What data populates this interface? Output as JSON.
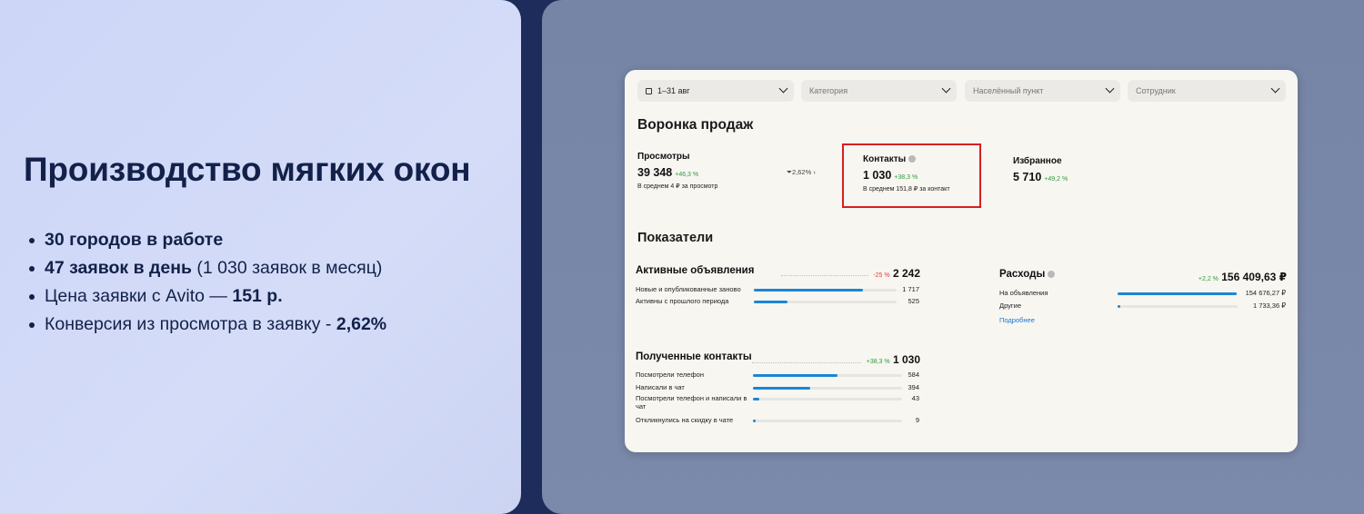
{
  "slide": {
    "title": "Производство мягких окон",
    "bullets": [
      {
        "bold": "30 городов в работе",
        "text": ""
      },
      {
        "bold": "47 заявок в день",
        "text": " (1 030 заявок в месяц)"
      },
      {
        "text": "Цена заявки с Avito — ",
        "bold": "151 р."
      },
      {
        "text": "Конверсия из просмотра в заявку - ",
        "bold": "2,62%"
      }
    ]
  },
  "filters": {
    "period": "1–31 авг",
    "category": "Категория",
    "location": "Населённый пункт",
    "employee": "Сотрудник"
  },
  "funnel": {
    "title": "Воронка продаж",
    "views": {
      "label": "Просмотры",
      "value": "39 348",
      "delta": "+46,3 %",
      "sub": "В среднем 4 ₽ за просмотр"
    },
    "conversion": "2,62%",
    "contacts": {
      "label": "Контакты",
      "value": "1 030",
      "delta": "+38,3 %",
      "sub": "В среднем 151,8 ₽ за контакт"
    },
    "favorites": {
      "label": "Избранное",
      "value": "5 710",
      "delta": "+49,2 %"
    }
  },
  "indicators": {
    "title": "Показатели",
    "active_ads": {
      "title": "Активные объявления",
      "delta": "-25 %",
      "total": "2 242",
      "rows": [
        {
          "label": "Новые и опубликованные заново",
          "value": "1 717",
          "fraction": 0.766
        },
        {
          "label": "Активны с прошлого периода",
          "value": "525",
          "fraction": 0.234
        }
      ]
    },
    "expenses": {
      "title": "Расходы",
      "delta": "+2,2 %",
      "total": "156 409,63 ₽",
      "rows": [
        {
          "label": "На объявления",
          "value": "154 676,27 ₽",
          "fraction": 0.989
        },
        {
          "label": "Другие",
          "value": "1 733,36 ₽",
          "fraction": 0.011
        }
      ],
      "link": "Подробнее"
    },
    "contacts": {
      "title": "Полученные контакты",
      "delta": "+38,3 %",
      "total": "1 030",
      "rows": [
        {
          "label": "Посмотрели телефон",
          "value": "584",
          "fraction": 0.567
        },
        {
          "label": "Написали в чат",
          "value": "394",
          "fraction": 0.383
        },
        {
          "label": "Посмотрели телефон и написали в чат",
          "value": "43",
          "fraction": 0.042
        },
        {
          "label": "Откликнулись на скидку в чате",
          "value": "9",
          "fraction": 0.009
        }
      ]
    }
  },
  "colors": {
    "accent_bar": "#1b86d6",
    "positive": "#2e9b3b",
    "negative": "#e03b3b",
    "highlight_frame": "#d71f1f",
    "slide_text": "#13214a"
  }
}
